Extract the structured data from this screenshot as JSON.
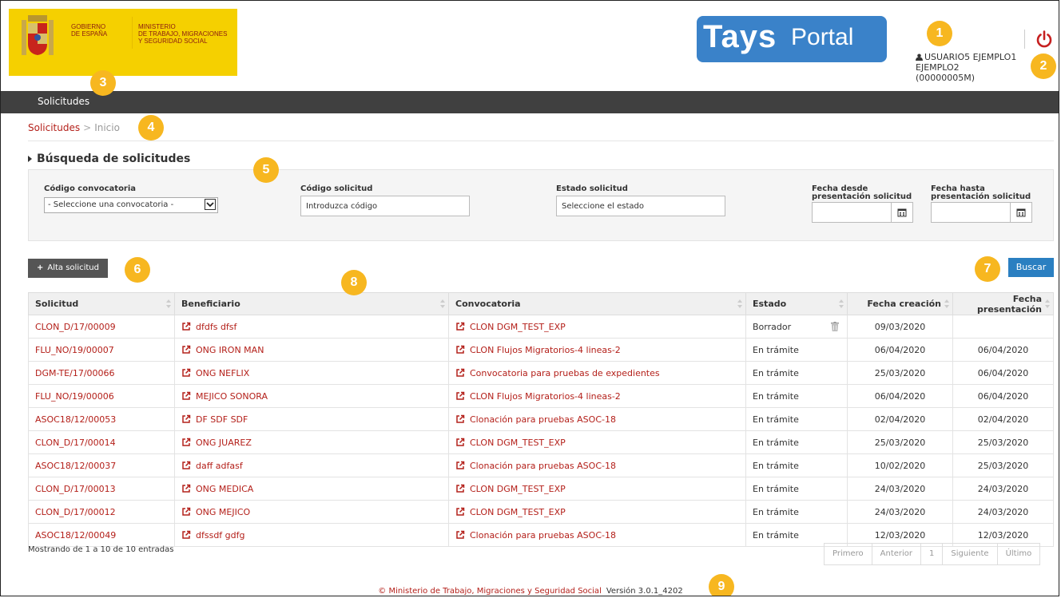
{
  "header": {
    "gov_line1": "GOBIERNO\nDE ESPAÑA",
    "gov_line2": "MINISTERIO\nDE TRABAJO, MIGRACIONES\nY SEGURIDAD SOCIAL",
    "brand_bold": "Tays",
    "brand_light": "Portal",
    "user_name": "USUARIO5 EJEMPLO1 EJEMPLO2",
    "user_id": "(00000005M)"
  },
  "nav": {
    "solicitudes": "Solicitudes"
  },
  "breadcrumb": {
    "first": "Solicitudes",
    "sep": ">",
    "current": "Inicio"
  },
  "search": {
    "title": "Búsqueda de solicitudes",
    "convocatoria_label": "Código convocatoria",
    "convocatoria_value": "- Seleccione una convocatoria -",
    "solicitud_label": "Código solicitud",
    "solicitud_placeholder": "Introduzca código",
    "estado_label": "Estado solicitud",
    "estado_placeholder": "Seleccione el estado",
    "desde_label": "Fecha desde presentación solicitud",
    "hasta_label": "Fecha hasta presentación solicitud"
  },
  "actions": {
    "alta": "Alta solicitud",
    "buscar": "Buscar"
  },
  "table": {
    "headers": [
      "Solicitud",
      "Beneficiario",
      "Convocatoria",
      "Estado",
      "Fecha creación",
      "Fecha presentación"
    ],
    "rows": [
      [
        "CLON_D/17/00009",
        "dfdfs dfsf",
        "CLON DGM_TEST_EXP",
        "Borrador",
        "09/03/2020",
        ""
      ],
      [
        "FLU_NO/19/00007",
        "ONG IRON MAN",
        "CLON Flujos Migratorios-4 lineas-2",
        "En trámite",
        "06/04/2020",
        "06/04/2020"
      ],
      [
        "DGM-TE/17/00066",
        "ONG NEFLIX",
        "Convocatoria para pruebas de expedientes",
        "En trámite",
        "25/03/2020",
        "06/04/2020"
      ],
      [
        "FLU_NO/19/00006",
        "MEJICO SONORA",
        "CLON Flujos Migratorios-4 lineas-2",
        "En trámite",
        "06/04/2020",
        "06/04/2020"
      ],
      [
        "ASOC18/12/00053",
        "DF SDF SDF",
        "Clonación para pruebas ASOC-18",
        "En trámite",
        "02/04/2020",
        "02/04/2020"
      ],
      [
        "CLON_D/17/00014",
        "ONG JUAREZ",
        "CLON DGM_TEST_EXP",
        "En trámite",
        "25/03/2020",
        "25/03/2020"
      ],
      [
        "ASOC18/12/00037",
        "daff adfasf",
        "Clonación para pruebas ASOC-18",
        "En trámite",
        "10/02/2020",
        "25/03/2020"
      ],
      [
        "CLON_D/17/00013",
        "ONG MEDICA",
        "CLON DGM_TEST_EXP",
        "En trámite",
        "24/03/2020",
        "24/03/2020"
      ],
      [
        "CLON_D/17/00012",
        "ONG MEJICO",
        "CLON DGM_TEST_EXP",
        "En trámite",
        "24/03/2020",
        "24/03/2020"
      ],
      [
        "ASOC18/12/00049",
        "dfssdf gdfg",
        "Clonación para pruebas ASOC-18",
        "En trámite",
        "12/03/2020",
        "12/03/2020"
      ]
    ]
  },
  "pagination": {
    "info": "Mostrando de 1 a 10 de 10 entradas",
    "first": "Primero",
    "prev": "Anterior",
    "page": "1",
    "next": "Siguiente",
    "last": "Último"
  },
  "footer": {
    "copyright": "© Ministerio de Trabajo, Migraciones y Seguridad Social",
    "version": "Versión 3.0.1_4202"
  },
  "callouts": [
    "1",
    "2",
    "3",
    "4",
    "5",
    "6",
    "7",
    "8",
    "9"
  ],
  "colors": {
    "accent_red": "#b4201a",
    "nav_dark": "#404040",
    "brand_blue": "#3a82c9",
    "callout": "#f7b720",
    "gov_yellow": "#f5d000"
  }
}
